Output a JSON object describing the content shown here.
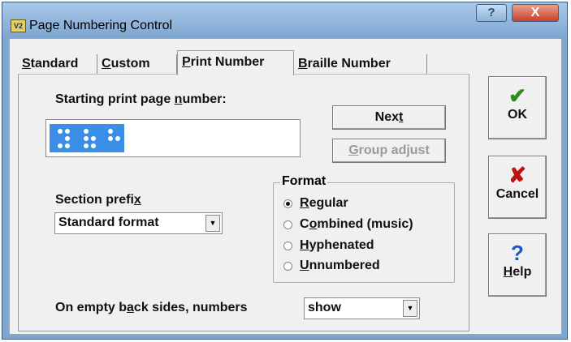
{
  "window": {
    "title": "Page Numbering Control",
    "app_icon_text": "V2",
    "help_glyph": "?",
    "close_glyph": "X"
  },
  "tabs": [
    {
      "pre": "",
      "key": "S",
      "post": "tandard",
      "active": false
    },
    {
      "pre": "",
      "key": "C",
      "post": "ustom",
      "active": false
    },
    {
      "pre": "",
      "key": "P",
      "post": "rint Number",
      "active": true
    },
    {
      "pre": "",
      "key": "B",
      "post": "raille Number",
      "active": false
    }
  ],
  "starting": {
    "pre": "Starting print page ",
    "key": "n",
    "post": "umber:",
    "value_braille": "⠼⠁⠃"
  },
  "next_button": {
    "pre": "Nex",
    "key": "t",
    "post": ""
  },
  "group_adjust_button": {
    "pre": "",
    "key": "G",
    "post": "roup adjust",
    "enabled": false
  },
  "section_prefix": {
    "pre": "Section prefi",
    "key": "x",
    "post": "",
    "value": "Standard format"
  },
  "format": {
    "title": "Format",
    "options": [
      {
        "pre": "",
        "key": "R",
        "post": "egular",
        "checked": true
      },
      {
        "pre": "C",
        "key": "o",
        "post": "mbined (music)",
        "checked": false
      },
      {
        "pre": "",
        "key": "H",
        "post": "yphenated",
        "checked": false
      },
      {
        "pre": "",
        "key": "U",
        "post": "nnumbered",
        "checked": false
      }
    ]
  },
  "empty_back": {
    "pre": "On empty b",
    "key": "a",
    "post": "ck sides, numbers",
    "value": "show"
  },
  "side_buttons": {
    "ok": {
      "icon": "✔",
      "label": "OK",
      "color": "#2e8b1e"
    },
    "cancel": {
      "icon": "✘",
      "label": "Cancel",
      "color": "#c01010"
    },
    "help": {
      "icon": "?",
      "pre": "",
      "key": "H",
      "post": "elp",
      "color": "#1a56c4"
    }
  }
}
